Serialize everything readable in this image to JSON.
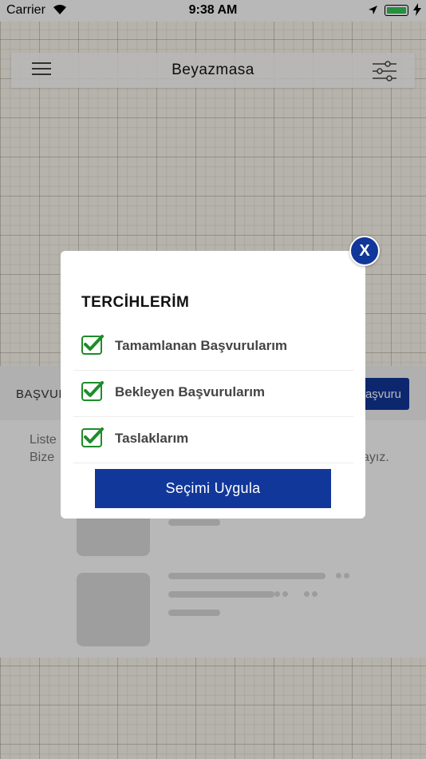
{
  "status_bar": {
    "carrier": "Carrier",
    "time": "9:38 AM",
    "icons": [
      "wifi-icon",
      "location-arrow-icon",
      "battery-icon",
      "charging-bolt-icon"
    ],
    "battery_color": "#35c659"
  },
  "nav": {
    "title": "Beyazmasa",
    "icons": [
      "hamburger-menu-icon",
      "filter-sliders-icon"
    ]
  },
  "section": {
    "title": "BAŞVUI",
    "new_button_label": "aşvuru",
    "info_line1": "Liste",
    "info_line2": "Bize",
    "info_line2_end": "ayız."
  },
  "modal": {
    "title": "TERCİHLERİM",
    "options": [
      {
        "label": "Tamamlanan Başvurularım",
        "checked": true
      },
      {
        "label": "Bekleyen Başvurularım",
        "checked": true
      },
      {
        "label": "Taslaklarım",
        "checked": true
      }
    ],
    "apply_label": "Seçimi Uygula",
    "close_label": "X"
  },
  "colors": {
    "accent": "#12379a",
    "check": "#1e8c2a"
  }
}
